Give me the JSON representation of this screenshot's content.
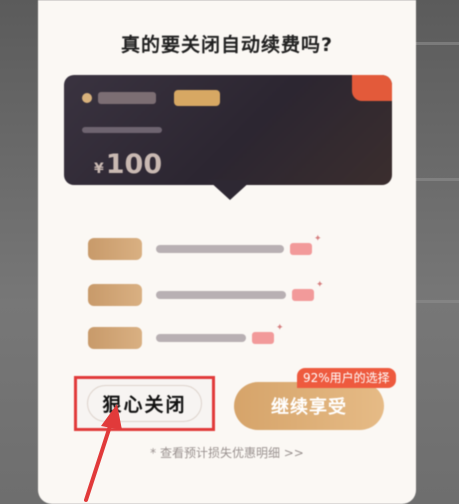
{
  "dialog": {
    "title": "真的要关闭自动续费吗?",
    "card": {
      "currency": "¥",
      "amount": "100"
    },
    "close_button": "狠心关闭",
    "continue_button": "继续享受",
    "choice_badge": "92%用户的选择",
    "footer_link": "* 查看预计损失优惠明细 >>"
  },
  "colors": {
    "accent_gold": "#d6a46a",
    "badge_red": "#ee5a3e",
    "highlight_red": "#e13a3a",
    "card_dark": "#2c2631"
  }
}
